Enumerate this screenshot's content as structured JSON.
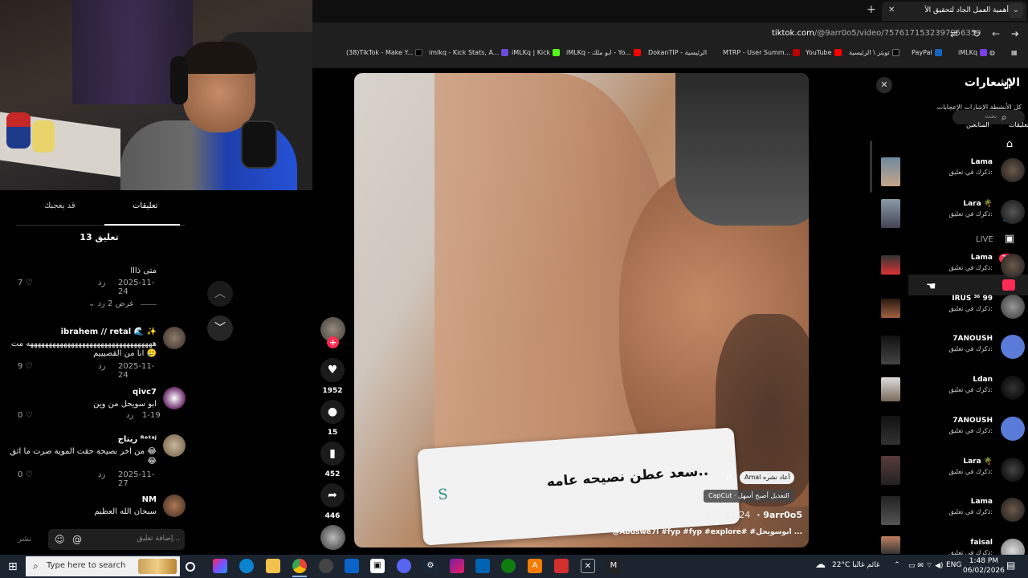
{
  "browser": {
    "tab_title": "أهمية العمل الجاد لتحقيق الأ",
    "url_domain": "tiktok.com",
    "url_path": "/@9arr0o5/video/7576171532397956359",
    "bookmarks": [
      "(38)TikTok - Make Y...",
      "imlkq - Kick Stats, A...",
      "iMLKq | Kick",
      "iMLKq - ابو ملك - Yo...",
      "DokanTIP - الرئيسية",
      "MTRP - User Summ...",
      "YouTube",
      "تويتر \\ الرئيسية",
      "PayPal",
      "iMLKq"
    ]
  },
  "left_panel": {
    "tabs": [
      "تعليقات",
      "قد يعجبك"
    ],
    "comments_count": "13 تعليق",
    "view_replies": "عرض 2 رد",
    "reply_label": "رد",
    "comments": [
      {
        "user": "",
        "text": "متى ذااا",
        "likes": "7",
        "date": "2025-11-24"
      },
      {
        "user": "ibrahem // retal 🌊 ✨",
        "text": "ههههههههههههههههههههههههههههههههههه مت انا من القصيييم 🥲",
        "likes": "9",
        "date": "2025-11-24"
      },
      {
        "user": "qivc7",
        "text": "ابو سويحل من وين",
        "likes": "0",
        "date": "1-19"
      },
      {
        "user": "ريتاج ᴿᵉᵗᵃʲ",
        "text": "من اخر نصيحة حقت الموية صرت ما اثق 😂😂",
        "likes": "0",
        "date": "2025-11-27"
      },
      {
        "user": "NM",
        "text": "سبحان الله العظيم",
        "likes": "",
        "date": ""
      }
    ],
    "input_placeholder": "إضافة تعليق...",
    "post_label": "نشر"
  },
  "video": {
    "caption_text": "سعد عطن نصيحه عامه..",
    "caption_letter": "S",
    "repost_text": "Amal أعاد نشره",
    "capcut_text": "CapCut · التعديل أصبح أسهل",
    "author": "9arr0o5",
    "date": "2025-11-24",
    "hashtags": "@Abuswe7l #fyp #fyp #explore# #ابوسويحل ..."
  },
  "actions": {
    "likes": "1952",
    "comments": "15",
    "saves": "452",
    "shares": "446"
  },
  "notifications": {
    "title": "الإشعارات",
    "subtitle": "كل الأنشطة    الإشارات    الإعجابات",
    "search_placeholder": "بحث",
    "filter_1": "المتابعين",
    "filter_2": "تعليقات",
    "live_label": "LIVE",
    "badge": "24",
    "items": [
      {
        "name": "Lama",
        "text": "ذكرك في تعليق:"
      },
      {
        "name": "Lara 🌴",
        "text": "ذكرك في تعليق:"
      },
      {
        "name": "Lama",
        "text": "ذكرك في تعليق:"
      },
      {
        "name": "IRUS ³⁶ 99",
        "text": "ذكرك في تعليق:"
      },
      {
        "name": "7ANOUSH",
        "text": "ذكرك في تعليق:"
      },
      {
        "name": "Ldan",
        "text": "ذكرك في تعليق:"
      },
      {
        "name": "7ANOUSH",
        "text": "ذكرك في تعليق:"
      },
      {
        "name": "Lara 🌴",
        "text": "ذكرك في تعليق:"
      },
      {
        "name": "Lama",
        "text": "ذكرك في تعليق:"
      },
      {
        "name": "faisal",
        "text": "ذكرك في تعليق:"
      }
    ]
  },
  "taskbar": {
    "search_placeholder": "Type here to search",
    "weather": "22°C  غائم غالبا",
    "lang": "ENG",
    "time": "1:48 PM",
    "date": "06/02/2026"
  }
}
